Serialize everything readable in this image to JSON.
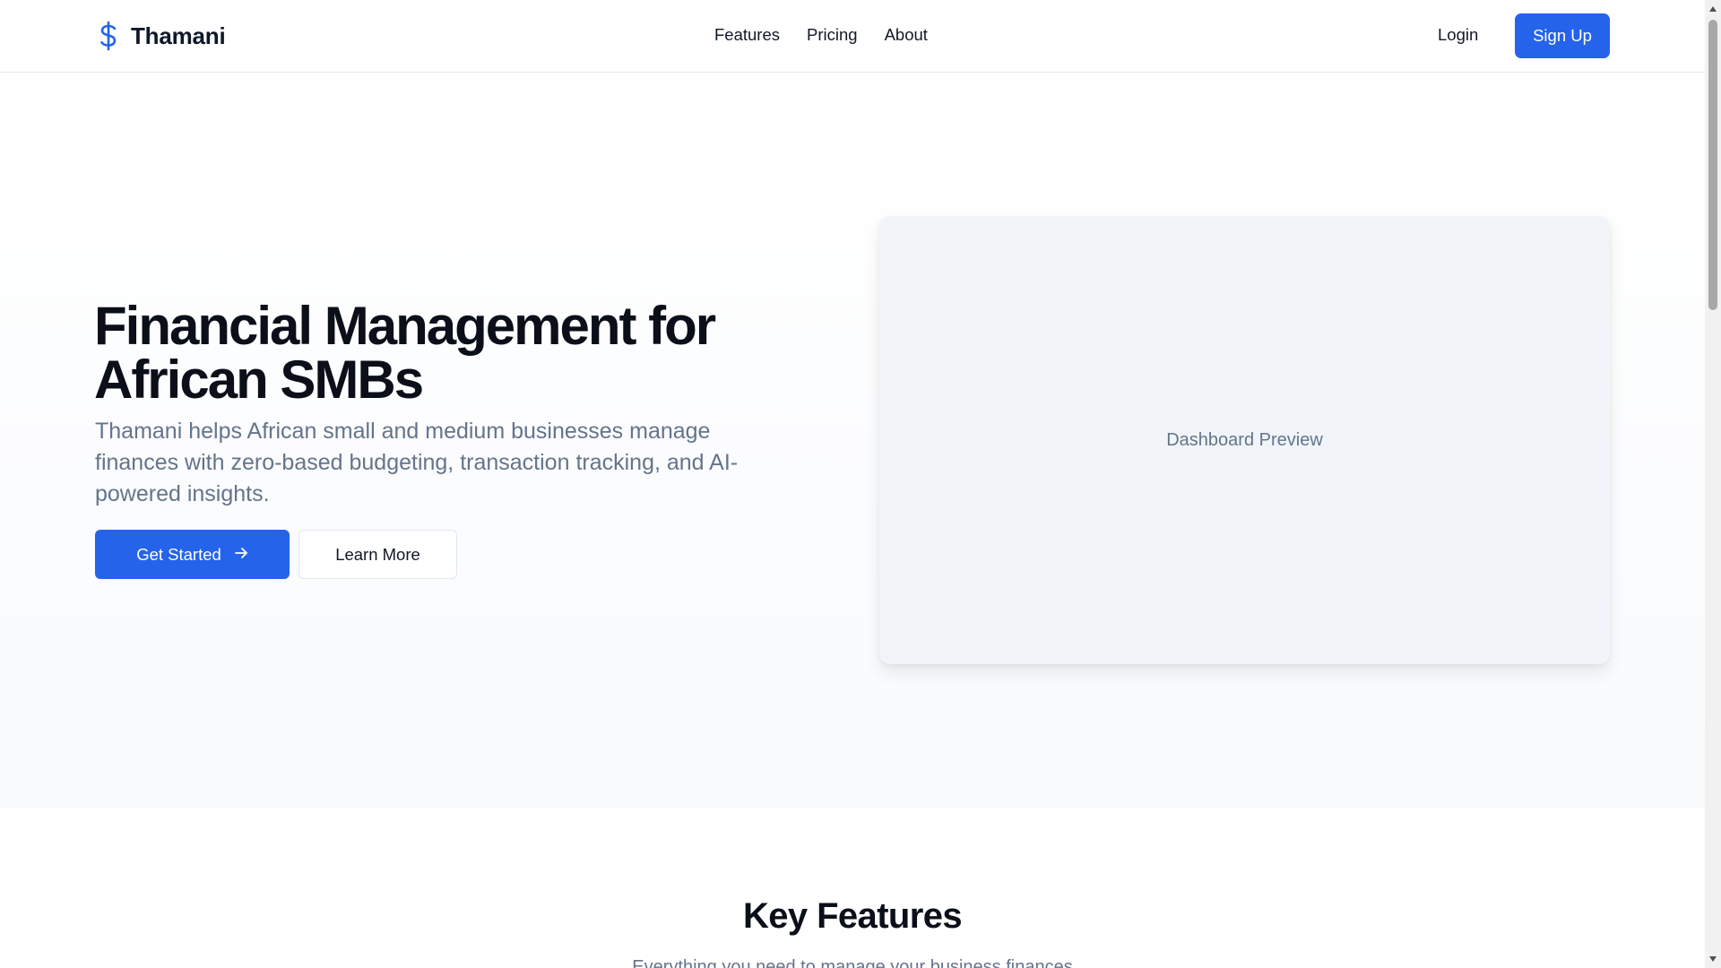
{
  "header": {
    "brand_name": "Thamani",
    "brand_icon": "dollar-sign-icon",
    "nav": [
      {
        "label": "Features"
      },
      {
        "label": "Pricing"
      },
      {
        "label": "About"
      }
    ],
    "login_label": "Login",
    "signup_label": "Sign Up"
  },
  "hero": {
    "title": "Financial Management for African SMBs",
    "description": "Thamani helps African small and medium businesses manage finances with zero-based budgeting, transaction tracking, and AI-powered insights.",
    "primary_button": "Get Started",
    "primary_button_icon": "arrow-right-icon",
    "secondary_button": "Learn More",
    "preview_label": "Dashboard Preview"
  },
  "features": {
    "title": "Key Features",
    "subtitle": "Everything you need to manage your business finances"
  },
  "colors": {
    "accent": "#2563eb",
    "text_primary": "#0f172a",
    "text_muted": "#64748b",
    "preview_bg": "#f1f5f9"
  }
}
